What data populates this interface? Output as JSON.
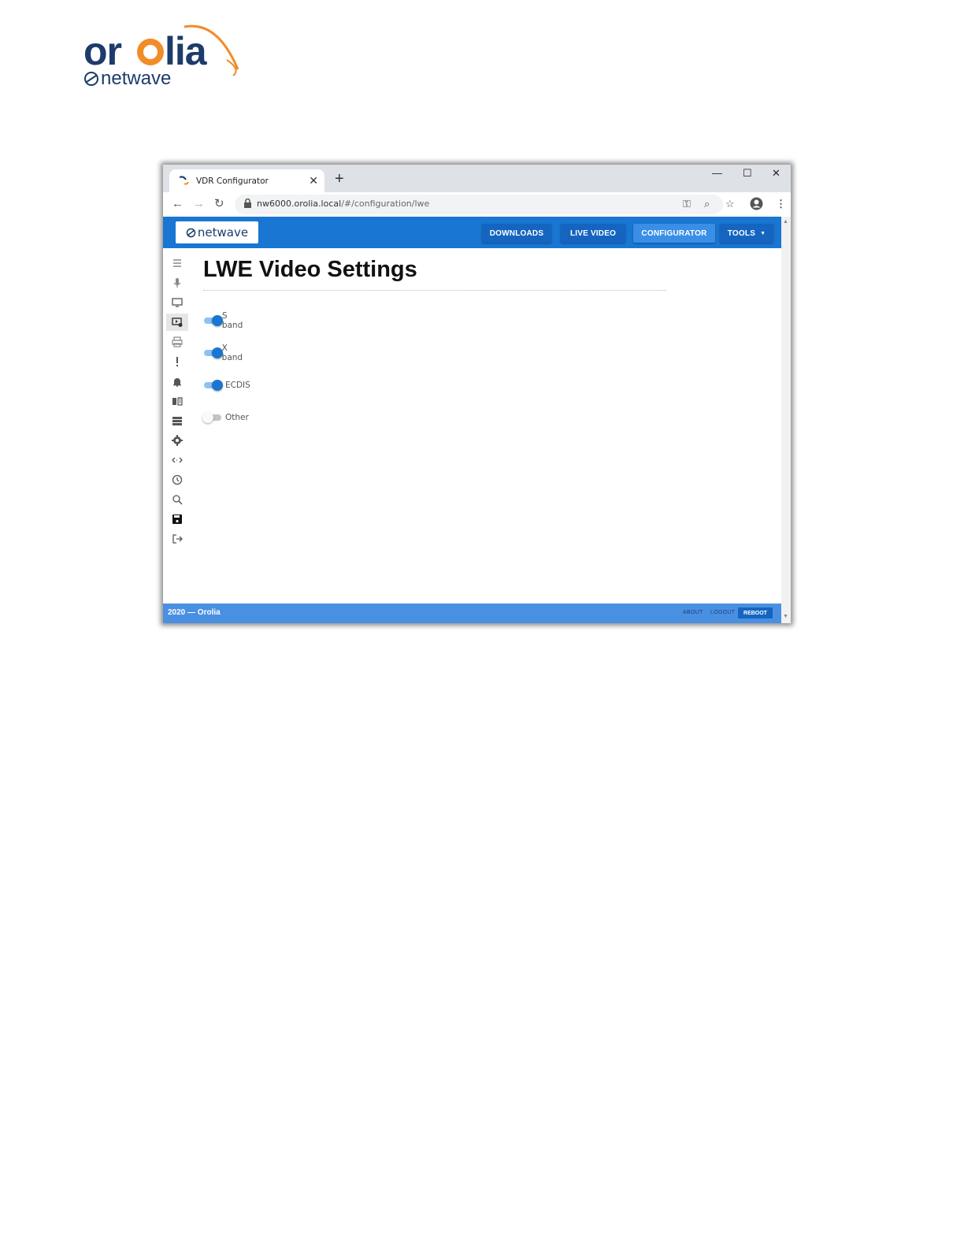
{
  "document": {
    "logo": {
      "brand": "orolia",
      "sub": "netwave",
      "colors": {
        "navy": "#1d3b6b",
        "orange": "#f28c28"
      }
    }
  },
  "browser": {
    "tab_title": "VDR Configurator",
    "url_host": "nw6000.orolia.local",
    "url_path": "/#/configuration/lwe",
    "icons": [
      "back-icon",
      "forward-icon",
      "reload-icon",
      "lock-icon",
      "key-icon",
      "zoom-icon",
      "star-icon",
      "account-icon",
      "menu-icon"
    ]
  },
  "app": {
    "brand_text": "netwave",
    "nav": {
      "downloads": "DOWNLOADS",
      "live_video": "LIVE VIDEO",
      "configurator": "CONFIGURATOR",
      "tools": "TOOLS",
      "active": "CONFIGURATOR"
    },
    "sidebar_icons": [
      "list-icon",
      "microphone-icon",
      "monitor-icon",
      "video-settings-icon",
      "printer-icon",
      "exclamation-icon",
      "bell-icon",
      "book-icon",
      "storage-icon",
      "gear-icon",
      "code-icon",
      "history-icon",
      "search-icon",
      "save-icon",
      "logout-icon"
    ],
    "sidebar_active": "video-settings-icon",
    "page_title": "LWE Video Settings",
    "toggles": [
      {
        "label": "S band",
        "on": true
      },
      {
        "label": "X band",
        "on": true
      },
      {
        "label": "ECDIS",
        "on": true
      },
      {
        "label": "Other",
        "on": false
      }
    ],
    "footer": {
      "copyright": "2020 — Orolia",
      "about": "ABOUT",
      "logout": "LOGOUT",
      "reboot": "REBOOT"
    },
    "colors": {
      "primary": "#1976d2",
      "footer": "#4a90e2"
    }
  }
}
